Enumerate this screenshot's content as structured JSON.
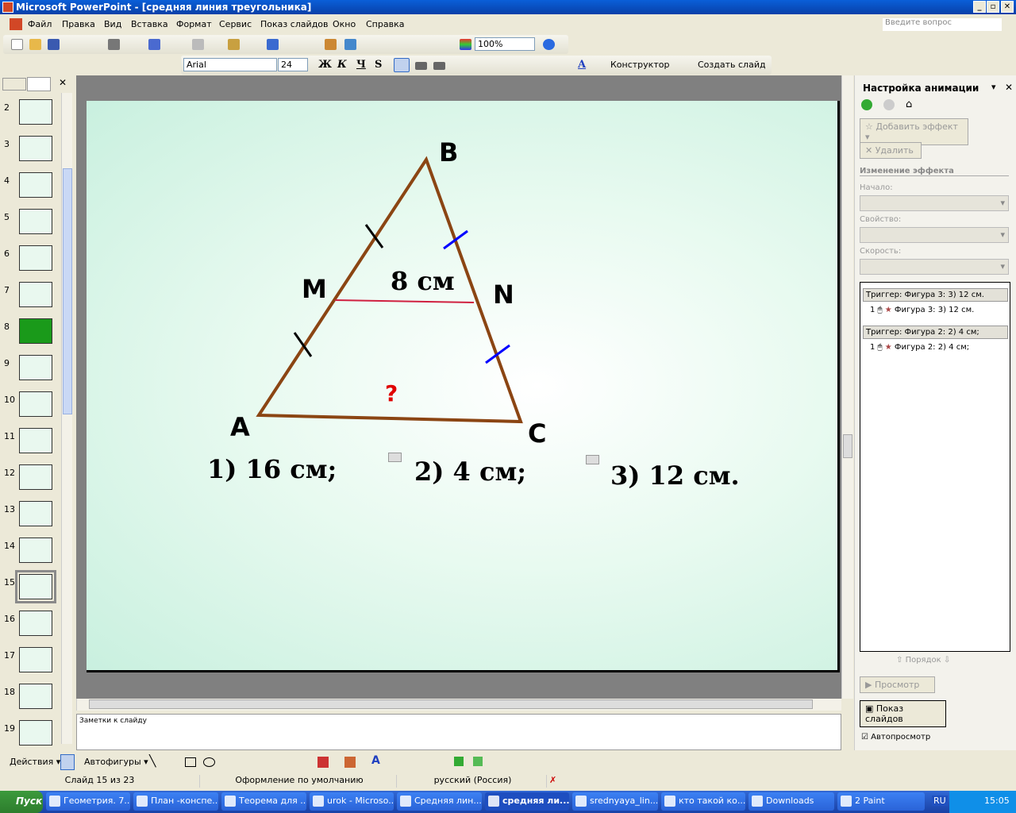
{
  "window": {
    "title": "Microsoft PowerPoint - [средняя линия треугольника]"
  },
  "menu": {
    "items": [
      "Файл",
      "Правка",
      "Вид",
      "Вставка",
      "Формат",
      "Сервис",
      "Показ слайдов",
      "Окно",
      "Справка"
    ],
    "help_placeholder": "Введите вопрос"
  },
  "toolbar": {
    "zoom": "100%",
    "font": "Arial",
    "size": "24",
    "bold": "Ж",
    "italic": "К",
    "underline": "Ч",
    "shadow": "S",
    "designer": "Конструктор",
    "new_slide": "Создать слайд"
  },
  "slides_pane": {
    "numbers": [
      "2",
      "3",
      "4",
      "5",
      "6",
      "7",
      "8",
      "9",
      "10",
      "11",
      "12",
      "13",
      "14",
      "15",
      "16",
      "17",
      "18",
      "19"
    ],
    "selected": "15"
  },
  "slide": {
    "vertex_a": "A",
    "vertex_b": "B",
    "vertex_c": "C",
    "point_m": "M",
    "point_n": "N",
    "midline": "8 см",
    "question": "?",
    "answers": [
      "1)  16 см;",
      "2) 4 см;",
      "3) 12 см."
    ],
    "colors": {
      "triangle": "#8b4513",
      "midline": "#d02040",
      "ticks_left": "#000000",
      "ticks_right": "#0000ff",
      "question": "#e00000"
    }
  },
  "notes": {
    "placeholder": "Заметки к слайду"
  },
  "task_pane": {
    "title": "Настройка анимации",
    "add_effect": "Добавить эффект",
    "delete": "Удалить",
    "section": "Изменение эффекта",
    "start_label": "Начало:",
    "property_label": "Свойство:",
    "speed_label": "Скорость:",
    "list": [
      {
        "trigger": "Триггер: Фигура 3: 3) 12 см.",
        "item_num": "1",
        "item": "Фигура 3: 3) 12 см."
      },
      {
        "trigger": "Триггер: Фигура 2: 2) 4 см;",
        "item_num": "1",
        "item": "Фигура 2: 2) 4 см;"
      }
    ],
    "order": "Порядок",
    "preview": "Просмотр",
    "slideshow": "Показ слайдов",
    "autopreview": "Автопросмотр",
    "autopreview_checked": true
  },
  "draw_toolbar": {
    "actions": "Действия",
    "autoshapes": "Автофигуры"
  },
  "status": {
    "slide": "Слайд 15 из 23",
    "design": "Оформление по умолчанию",
    "language": "русский (Россия)"
  },
  "taskbar": {
    "start": "Пуск",
    "tasks": [
      "Геометрия. 7...",
      "План -конспе...",
      "Теорема для ...",
      "urok - Microso...",
      "Средняя лин...",
      "средняя ли...",
      "srednyaya_lin...",
      "кто такой ко...",
      "Downloads",
      "2 Paint"
    ],
    "active_index": 5,
    "lang": "RU",
    "clock": "15:05"
  }
}
